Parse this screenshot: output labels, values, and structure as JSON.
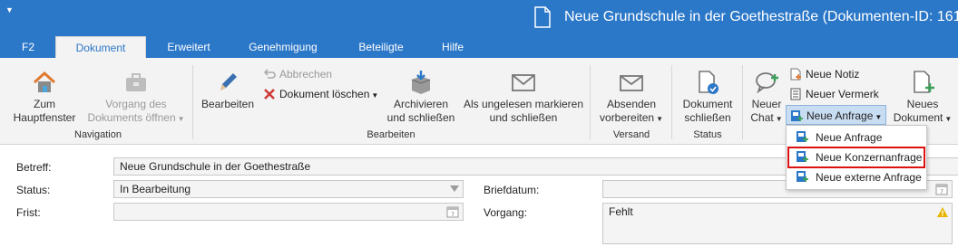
{
  "colors": {
    "accent": "#2b77c8",
    "ribbon_bg": "#f3f3f3",
    "highlight_border": "#d11",
    "status_warning": "#e8b400"
  },
  "window": {
    "title": "Neue Grundschule in der Goethestraße (Dokumenten-ID: 161"
  },
  "tabs": [
    {
      "label": "F2"
    },
    {
      "label": "Dokument"
    },
    {
      "label": "Erweitert"
    },
    {
      "label": "Genehmigung"
    },
    {
      "label": "Beteiligte"
    },
    {
      "label": "Hilfe"
    }
  ],
  "ribbon": {
    "navigation": {
      "label": "Navigation",
      "zum_hauptfenster": [
        "Zum",
        "Hauptfenster"
      ],
      "vorgang_oeffnen": [
        "Vorgang des",
        "Dokuments öffnen"
      ]
    },
    "bearbeiten": {
      "label": "Bearbeiten",
      "bearbeiten": "Bearbeiten",
      "abbrechen": "Abbrechen",
      "dokument_loeschen": "Dokument löschen",
      "archivieren": [
        "Archivieren",
        "und schließen"
      ],
      "ungelesen": [
        "Als ungelesen markieren",
        "und schließen"
      ]
    },
    "versand": {
      "label": "Versand",
      "absenden": [
        "Absenden",
        "vorbereiten"
      ]
    },
    "status": {
      "label": "Status",
      "dokument_schliessen": [
        "Dokument",
        "schließen"
      ]
    },
    "neu": {
      "neuer_chat": [
        "Neuer",
        "Chat"
      ],
      "neue_notiz": "Neue Notiz",
      "neuer_vermerk": "Neuer Vermerk",
      "neue_anfrage": "Neue Anfrage",
      "neues_dokument": [
        "Neues",
        "Dokument"
      ]
    }
  },
  "dropdown": {
    "items": [
      {
        "label": "Neue Anfrage"
      },
      {
        "label": "Neue Konzernanfrage"
      },
      {
        "label": "Neue externe Anfrage"
      }
    ]
  },
  "form": {
    "betreff_label": "Betreff:",
    "betreff_value": "Neue Grundschule in der Goethestraße",
    "status_label": "Status:",
    "status_value": "In Bearbeitung",
    "frist_label": "Frist:",
    "frist_value": "",
    "briefdatum_label": "Briefdatum:",
    "briefdatum_value": "",
    "vorgang_label": "Vorgang:",
    "vorgang_value": "Fehlt"
  }
}
